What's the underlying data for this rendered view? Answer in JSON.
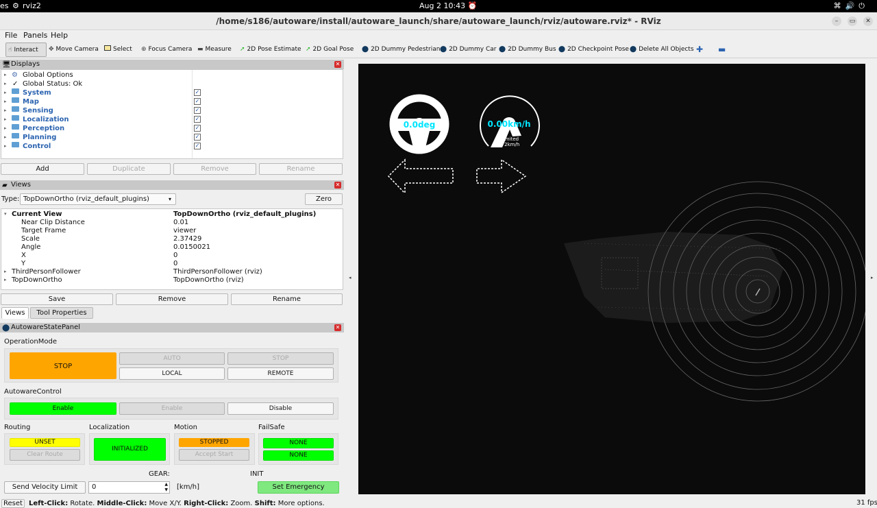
{
  "topbar": {
    "left1": "es",
    "app_name": "rviz2",
    "clock": "Aug 2  10:43"
  },
  "window": {
    "title": "/home/s186/autoware/install/autoware_launch/share/autoware_launch/rviz/autoware.rviz* - RViz"
  },
  "menu": {
    "file": "File",
    "panels": "Panels",
    "help": "Help"
  },
  "toolbar": {
    "interact": "Interact",
    "move_camera": "Move Camera",
    "select": "Select",
    "focus_camera": "Focus Camera",
    "measure": "Measure",
    "pose_estimate": "2D Pose Estimate",
    "goal_pose": "2D Goal Pose",
    "dummy_pedestrian": "2D Dummy Pedestrian",
    "dummy_car": "2D Dummy Car",
    "dummy_bus": "2D Dummy Bus",
    "checkpoint_pose": "2D Checkpoint Pose",
    "delete_all": "Delete All Objects"
  },
  "displays": {
    "title": "Displays",
    "global_options": "Global Options",
    "global_status": "Global Status: Ok",
    "items": [
      {
        "label": "System"
      },
      {
        "label": "Map"
      },
      {
        "label": "Sensing"
      },
      {
        "label": "Localization"
      },
      {
        "label": "Perception"
      },
      {
        "label": "Planning"
      },
      {
        "label": "Control"
      }
    ],
    "add": "Add",
    "duplicate": "Duplicate",
    "remove": "Remove",
    "rename": "Rename"
  },
  "views": {
    "title": "Views",
    "type_label": "Type:",
    "type_value": "TopDownOrtho (rviz_default_plugins)",
    "zero": "Zero",
    "current_view": "Current View",
    "current_view_value": "TopDownOrtho (rviz_default_plugins)",
    "props": [
      {
        "name": "Near Clip Distance",
        "value": "0.01"
      },
      {
        "name": "Target Frame",
        "value": "viewer"
      },
      {
        "name": "Scale",
        "value": "2.37429"
      },
      {
        "name": "Angle",
        "value": "0.0150021"
      },
      {
        "name": "X",
        "value": "0"
      },
      {
        "name": "Y",
        "value": "0"
      }
    ],
    "saved": [
      {
        "name": "ThirdPersonFollower",
        "value": "ThirdPersonFollower (rviz)"
      },
      {
        "name": "TopDownOrtho",
        "value": "TopDownOrtho (rviz)"
      }
    ],
    "save": "Save",
    "remove": "Remove",
    "rename": "Rename",
    "tab_views": "Views",
    "tab_tool": "Tool Properties"
  },
  "state_panel": {
    "title": "AutowareStatePanel",
    "operation_mode": "OperationMode",
    "stop_state": "STOP",
    "auto": "AUTO",
    "stop_btn": "STOP",
    "local": "LOCAL",
    "remote": "REMOTE",
    "autoware_control": "AutowareControl",
    "enable_state": "Enable",
    "enable_btn": "Enable",
    "disable": "Disable",
    "routing": "Routing",
    "routing_state": "UNSET",
    "clear_route": "Clear Route",
    "localization": "Localization",
    "localization_state": "INITIALIZED",
    "motion": "Motion",
    "motion_state": "STOPPED",
    "accept_start": "Accept Start",
    "failsafe": "FailSafe",
    "failsafe_1": "NONE",
    "failsafe_2": "NONE",
    "gear_label": "GEAR:",
    "init_label": "INIT",
    "send_velocity": "Send Velocity Limit",
    "velocity_value": "0",
    "unit": "[km/h]",
    "set_emergency": "Set Emergency"
  },
  "overlay": {
    "steering": "0.0deg",
    "speed": "0.00km/h",
    "limited": "limited",
    "limit_value": "72km/h"
  },
  "status": {
    "reset": "Reset",
    "left_click": "Left-Click:",
    "rotate": " Rotate. ",
    "middle_click": "Middle-Click:",
    "move": " Move X/Y. ",
    "right_click": "Right-Click:",
    "zoom": " Zoom. ",
    "shift": "Shift:",
    "more": " More options.",
    "fps": "31 fps"
  },
  "colors": {
    "orange": "#ffa500",
    "green": "#00ff00",
    "yellow": "#ffff00",
    "cyan": "#00e5ff",
    "light_green": "#7fe87f"
  }
}
